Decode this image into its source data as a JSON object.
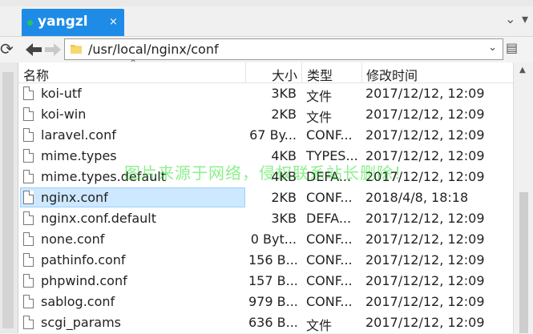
{
  "tab": {
    "title": "yangzl",
    "close": "×"
  },
  "address": {
    "path": "/usr/local/nginx/conf"
  },
  "columns": {
    "name": "名称",
    "size": "大小",
    "type": "类型",
    "modified": "修改时间"
  },
  "files": [
    {
      "name": "koi-utf",
      "size": "3KB",
      "type": "文件",
      "modified": "2017/12/12, 12:09"
    },
    {
      "name": "koi-win",
      "size": "2KB",
      "type": "文件",
      "modified": "2017/12/12, 12:09"
    },
    {
      "name": "laravel.conf",
      "size": "67 By...",
      "type": "CONF...",
      "modified": "2017/12/12, 12:09"
    },
    {
      "name": "mime.types",
      "size": "4KB",
      "type": "TYPES...",
      "modified": "2017/12/12, 12:09"
    },
    {
      "name": "mime.types.default",
      "size": "4KB",
      "type": "DEFA...",
      "modified": "2017/12/12, 12:09"
    },
    {
      "name": "nginx.conf",
      "size": "2KB",
      "type": "CONF...",
      "modified": "2018/4/8, 18:18"
    },
    {
      "name": "nginx.conf.default",
      "size": "3KB",
      "type": "DEFA...",
      "modified": "2017/12/12, 12:09"
    },
    {
      "name": "none.conf",
      "size": "0 Byt...",
      "type": "CONF...",
      "modified": "2017/12/12, 12:09"
    },
    {
      "name": "pathinfo.conf",
      "size": "156 B...",
      "type": "CONF...",
      "modified": "2017/12/12, 12:09"
    },
    {
      "name": "phpwind.conf",
      "size": "157 B...",
      "type": "CONF...",
      "modified": "2017/12/12, 12:09"
    },
    {
      "name": "sablog.conf",
      "size": "979 B...",
      "type": "CONF...",
      "modified": "2017/12/12, 12:09"
    },
    {
      "name": "scgi_params",
      "size": "636 B...",
      "type": "文件",
      "modified": "2017/12/12, 12:09"
    }
  ],
  "selected_index": 5,
  "watermark": "图片来源于网络，侵权联系站长删除！",
  "colors": {
    "tab": "#1e8be6",
    "selection": "#cde8ff",
    "watermark": "#00dc00"
  },
  "icons": [
    "refresh-icon",
    "back-arrow-icon",
    "forward-arrow-icon",
    "folder-icon",
    "chevron-down-icon",
    "file-icon",
    "sort-up-icon"
  ]
}
